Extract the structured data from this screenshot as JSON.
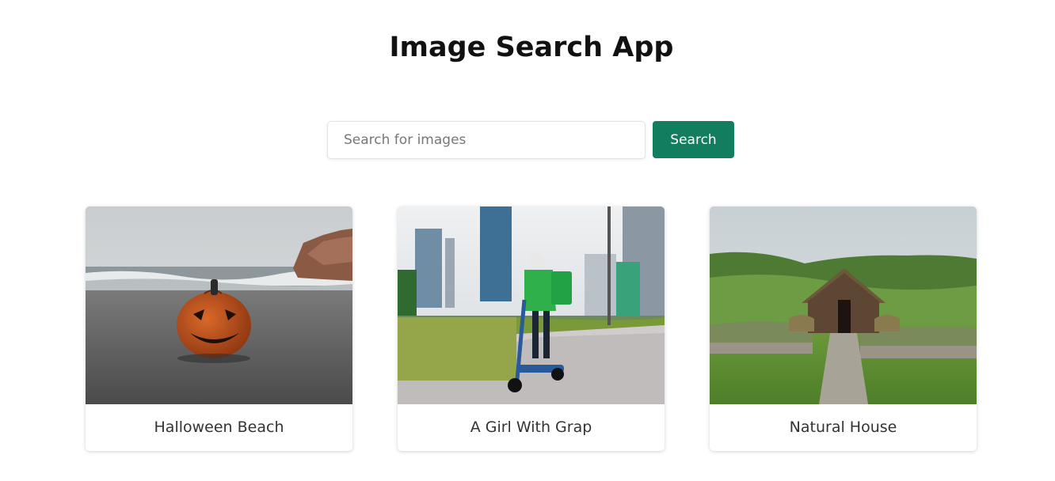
{
  "header": {
    "title": "Image Search App"
  },
  "search": {
    "placeholder": "Search for images",
    "value": "",
    "button_label": "Search"
  },
  "results": [
    {
      "caption": "Halloween Beach",
      "image": "pumpkin on beach"
    },
    {
      "caption": "A Girl With Grap",
      "image": "person on scooter in city"
    },
    {
      "caption": "Natural House",
      "image": "turf house on grassy hill"
    }
  ],
  "colors": {
    "accent": "#137e5f",
    "title": "#111111",
    "caption": "#333333"
  }
}
